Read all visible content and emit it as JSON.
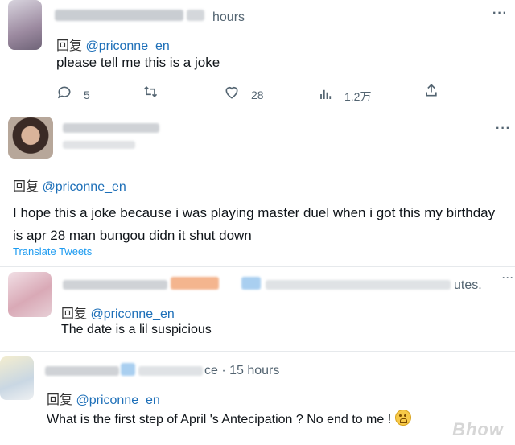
{
  "tweets": [
    {
      "time_suffix": "hours",
      "reply_prefix": "回复",
      "reply_handle": "@priconne_en",
      "text": "please tell me this is a joke",
      "actions": {
        "replies": "5",
        "retweets": "",
        "likes": "28",
        "views": "1.2万"
      }
    },
    {
      "reply_prefix": "回复",
      "reply_handle": "@priconne_en",
      "text": "I hope this a joke because i was playing master duel when i got this my birthday is apr 28 man bungou didn it shut down",
      "translate": "Translate Tweets"
    },
    {
      "time_suffix": "utes.",
      "reply_prefix": "回复",
      "reply_handle": "@priconne_en",
      "text": "The date is a lil suspicious"
    },
    {
      "time_suffix": "ce · 15 hours",
      "reply_prefix": "回复",
      "reply_handle": "@priconne_en",
      "text": "What is the first step of April 's Antecipation ? No end to me !"
    }
  ],
  "icons": {
    "reply": "speech-bubble-icon",
    "retweet": "retweet-icon",
    "like": "heart-icon",
    "views": "bar-chart-icon",
    "share": "share-icon",
    "more": "more-dots-icon",
    "emoji": "crying-face-emoji"
  },
  "colors": {
    "link": "#1d6fb8",
    "translate": "#1d9bf0",
    "muted": "#536471"
  }
}
